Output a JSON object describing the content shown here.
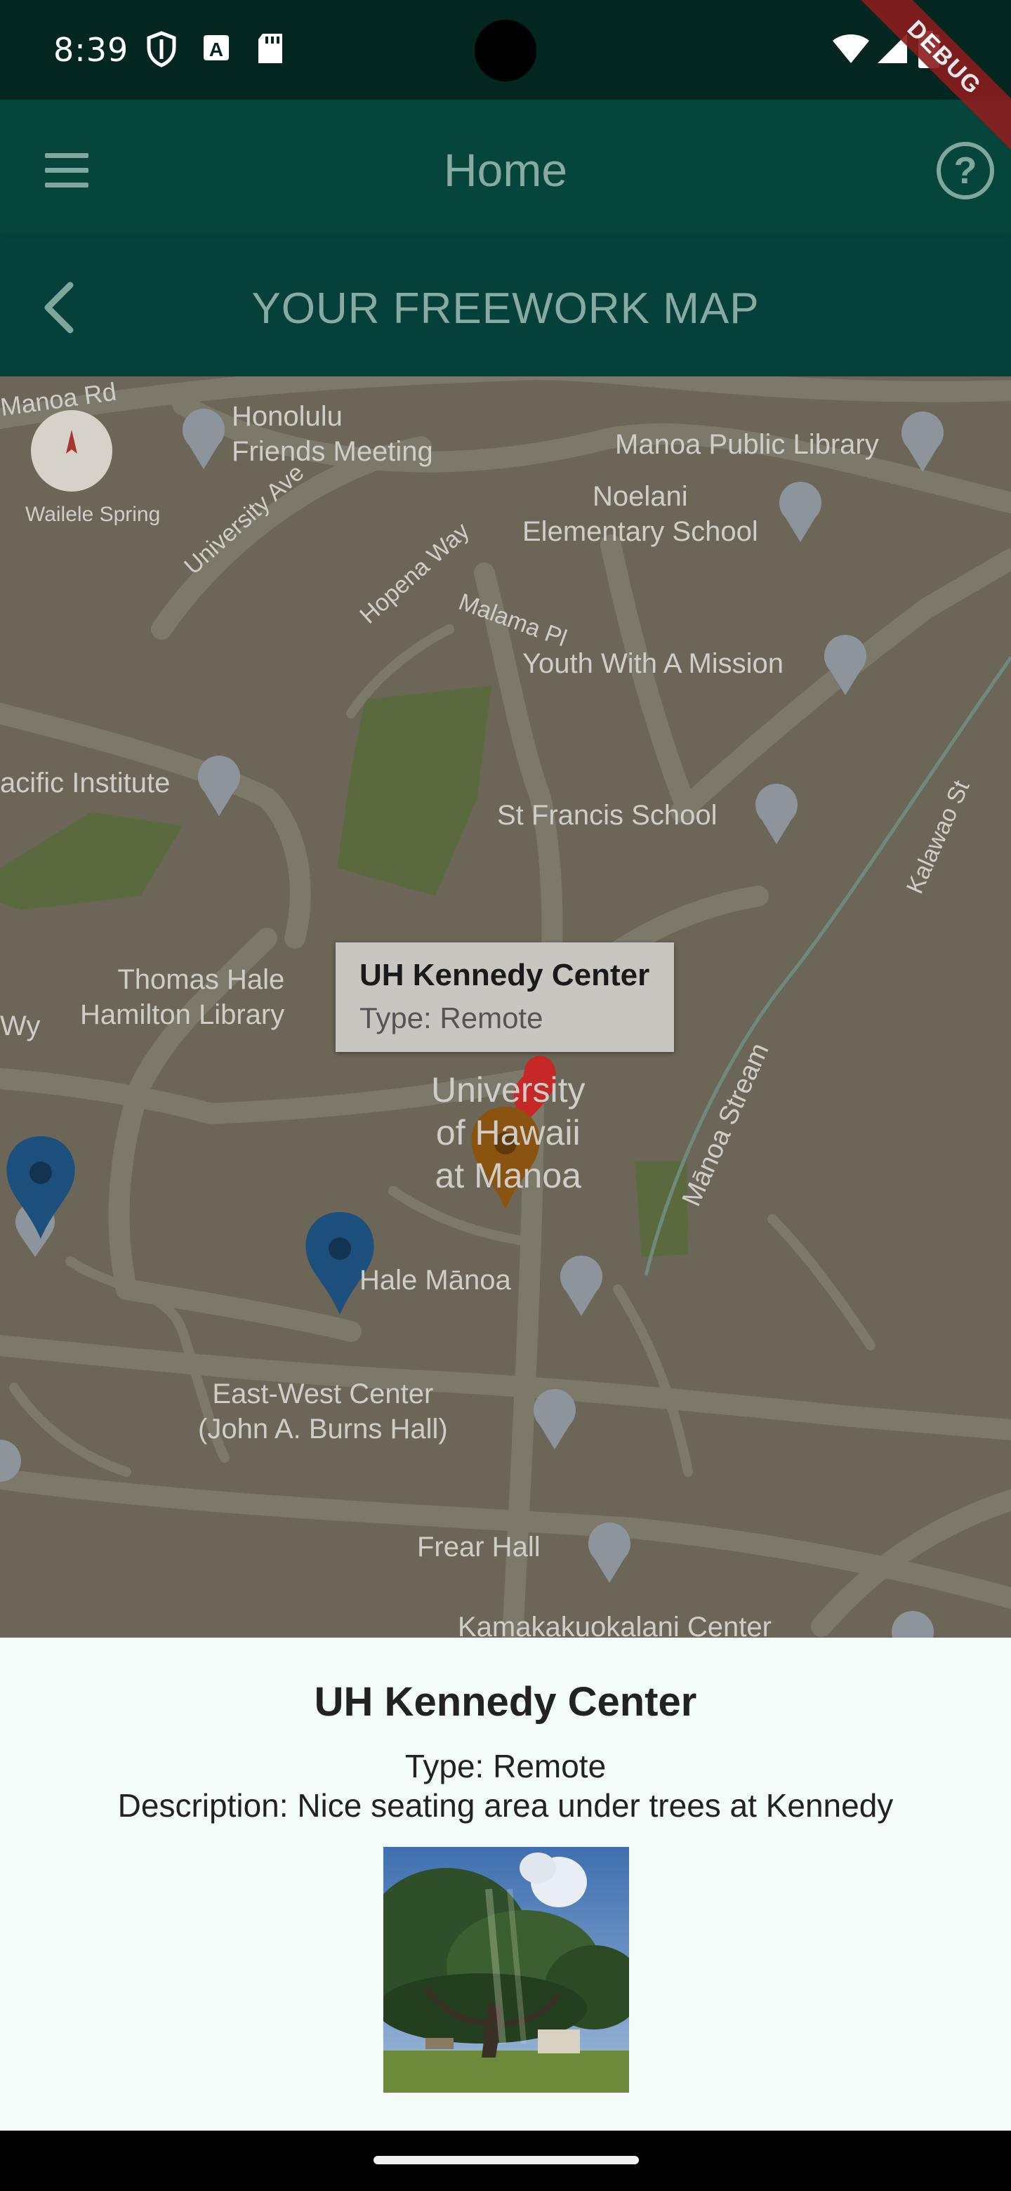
{
  "status_bar": {
    "time": "8:39",
    "icons": [
      "shield-icon",
      "a-icon",
      "sd-card-icon",
      "wifi-icon",
      "signal-icon",
      "battery-icon"
    ]
  },
  "debug_banner": "DEBUG",
  "app_bar": {
    "title": "Home",
    "menu_icon": "menu-icon",
    "help_icon": "help-icon"
  },
  "sub_bar": {
    "title": "YOUR FREEWORK MAP",
    "back_icon": "chevron-left-icon"
  },
  "map": {
    "labels": {
      "manoa_rd": "Manoa Rd",
      "honolulu_friends": "Honolulu\nFriends Meeting",
      "manoa_library": "Manoa Public Library",
      "noelani": "Noelani\nElementary School",
      "waileie": "Wailele Spring",
      "university_ave": "University Ave",
      "hopena_way": "Hopena Way",
      "malama_pl": "Malama Pl",
      "ywam": "Youth With A Mission",
      "pacific_institute": "acific Institute",
      "st_francis": "St Francis School",
      "kalawao": "Kalawao St",
      "hamilton": "Thomas Hale\nHamilton Library",
      "wy": "Wy",
      "manoa_stream": "Mānoa Stream",
      "uh_manoa": "University\nof Hawaii\nat Manoa",
      "hale_manoa": "Hale Mānoa",
      "east_west": "East-West Center\n(John A. Burns Hall)",
      "frear": "Frear Hall",
      "kamakakuokalani": "Kamakakuokalani Center"
    },
    "info_window": {
      "title": "UH Kennedy Center",
      "subtitle": "Type: Remote"
    },
    "marker_colors": {
      "red": "#c62828",
      "orange": "#8a5310",
      "blue": "#1c4f7c"
    }
  },
  "detail": {
    "title": "UH Kennedy Center",
    "type": "Type: Remote",
    "description": "Description: Nice seating area under trees at Kennedy"
  }
}
